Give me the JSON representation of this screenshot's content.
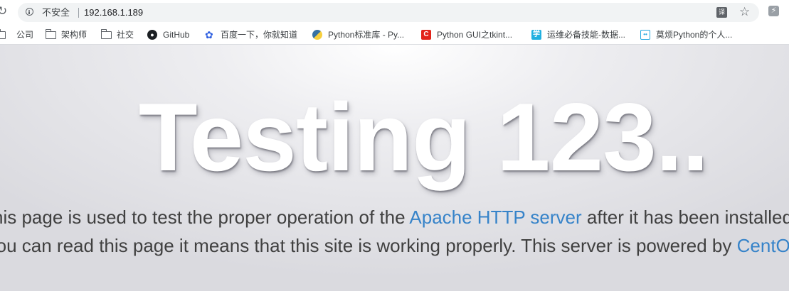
{
  "browser": {
    "security_label": "不安全",
    "url": "192.168.1.189",
    "translate_glyph": "译",
    "ext_glyph": "⚡"
  },
  "bookmarks": [
    {
      "label": "公司",
      "icon": "folder-icon"
    },
    {
      "label": "架构师",
      "icon": "folder-icon"
    },
    {
      "label": "社交",
      "icon": "folder-icon"
    },
    {
      "label": "GitHub",
      "icon": "github-icon"
    },
    {
      "label": "百度一下，你就知道",
      "icon": "baidu-icon"
    },
    {
      "label": "Python标准库 - Py...",
      "icon": "python-icon"
    },
    {
      "label": "Python GUI之tkint...",
      "icon": "csdn-icon"
    },
    {
      "label": "运维必备技能-数据...",
      "icon": "study-icon"
    },
    {
      "label": "莫烦Python的个人...",
      "icon": "bilibili-icon"
    }
  ],
  "page": {
    "headline": "Testing 123..",
    "p_part1": "This page is used to test the proper operation of the ",
    "p_link1": "Apache HTTP server",
    "p_part2": " after it has been installed. If you can read this page it means that this site is working properly. This server is powered by ",
    "p_link2": "CentOS",
    "p_part3": "."
  },
  "colors": {
    "link": "#3683c9",
    "text": "#404040"
  }
}
